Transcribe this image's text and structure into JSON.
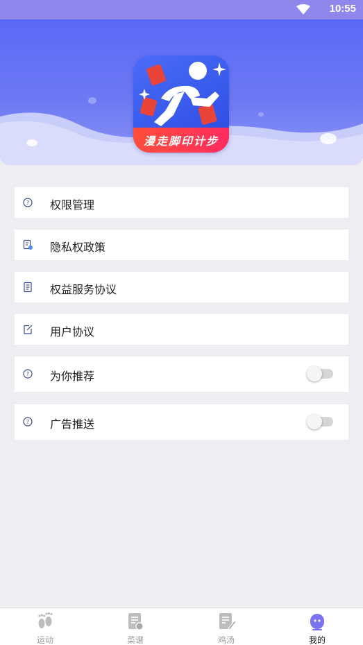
{
  "status_bar": {
    "time": "10:55",
    "wifi_icon": "wifi-icon"
  },
  "header": {
    "logo_icon": "running-man-logo-icon",
    "logo_text": "漫走脚印计步",
    "accent": "#5a69f6"
  },
  "menu": {
    "items": [
      {
        "label": "权限管理",
        "icon": "help-circle-icon"
      },
      {
        "label": "隐私权政策",
        "icon": "privacy-doc-icon"
      },
      {
        "label": "权益服务协议",
        "icon": "document-icon"
      },
      {
        "label": "用户协议",
        "icon": "edit-icon"
      },
      {
        "label": "为你推荐",
        "icon": "help-circle-icon",
        "toggle_on": false
      },
      {
        "label": "广告推送",
        "icon": "help-circle-icon",
        "toggle_on": false
      }
    ]
  },
  "bottom_nav": {
    "items": [
      {
        "label": "运动",
        "icon": "footprints-icon"
      },
      {
        "label": "菜谱",
        "icon": "recipe-icon"
      },
      {
        "label": "鸡汤",
        "icon": "notes-icon"
      },
      {
        "label": "我的",
        "icon": "profile-icon"
      }
    ],
    "active": "我的",
    "active_color": "#7b72f0",
    "inactive_color": "#bdbdbd"
  }
}
